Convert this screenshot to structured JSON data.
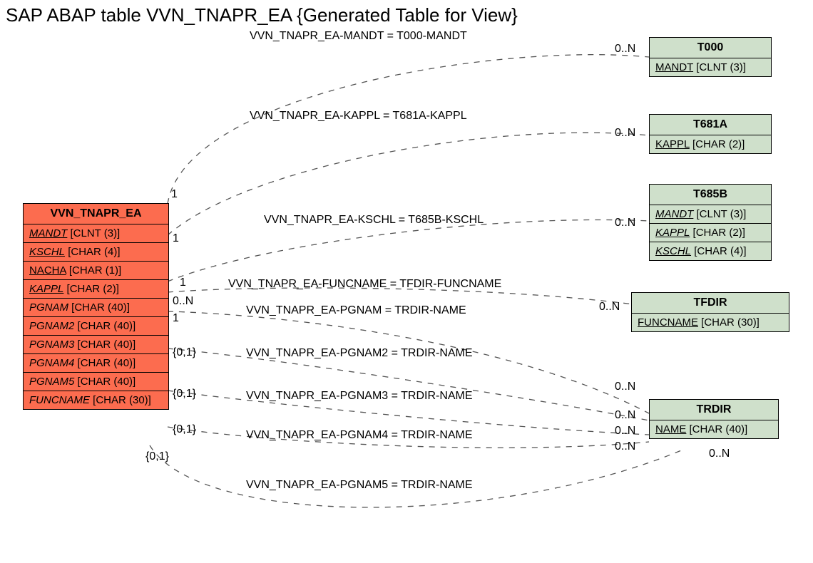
{
  "title": "SAP ABAP table VVN_TNAPR_EA {Generated Table for View}",
  "main": {
    "name": "VVN_TNAPR_EA",
    "cols": [
      {
        "field": "MANDT",
        "type": "[CLNT (3)]",
        "key": true
      },
      {
        "field": "KSCHL",
        "type": "[CHAR (4)]",
        "key": true
      },
      {
        "field": "NACHA",
        "type": "[CHAR (1)]",
        "key": false,
        "u": true
      },
      {
        "field": "KAPPL",
        "type": "[CHAR (2)]",
        "key": true
      },
      {
        "field": "PGNAM",
        "type": "[CHAR (40)]",
        "key": false,
        "i": true
      },
      {
        "field": "PGNAM2",
        "type": "[CHAR (40)]",
        "key": false,
        "i": true
      },
      {
        "field": "PGNAM3",
        "type": "[CHAR (40)]",
        "key": false,
        "i": true
      },
      {
        "field": "PGNAM4",
        "type": "[CHAR (40)]",
        "key": false,
        "i": true
      },
      {
        "field": "PGNAM5",
        "type": "[CHAR (40)]",
        "key": false,
        "i": true
      },
      {
        "field": "FUNCNAME",
        "type": "[CHAR (30)]",
        "key": false,
        "i": true
      }
    ]
  },
  "refs": [
    {
      "name": "T000",
      "cols": [
        {
          "field": "MANDT",
          "type": "[CLNT (3)]",
          "u": true
        }
      ]
    },
    {
      "name": "T681A",
      "cols": [
        {
          "field": "KAPPL",
          "type": "[CHAR (2)]",
          "u": true
        }
      ]
    },
    {
      "name": "T685B",
      "cols": [
        {
          "field": "MANDT",
          "type": "[CLNT (3)]",
          "key": true
        },
        {
          "field": "KAPPL",
          "type": "[CHAR (2)]",
          "key": true
        },
        {
          "field": "KSCHL",
          "type": "[CHAR (4)]",
          "key": true
        }
      ]
    },
    {
      "name": "TFDIR",
      "cols": [
        {
          "field": "FUNCNAME",
          "type": "[CHAR (30)]",
          "u": true
        }
      ]
    },
    {
      "name": "TRDIR",
      "cols": [
        {
          "field": "NAME",
          "type": "[CHAR (40)]",
          "u": true
        }
      ]
    }
  ],
  "rels": [
    "VVN_TNAPR_EA-MANDT = T000-MANDT",
    "VVN_TNAPR_EA-KAPPL = T681A-KAPPL",
    "VVN_TNAPR_EA-KSCHL = T685B-KSCHL",
    "VVN_TNAPR_EA-FUNCNAME = TFDIR-FUNCNAME",
    "VVN_TNAPR_EA-PGNAM = TRDIR-NAME",
    "VVN_TNAPR_EA-PGNAM2 = TRDIR-NAME",
    "VVN_TNAPR_EA-PGNAM3 = TRDIR-NAME",
    "VVN_TNAPR_EA-PGNAM4 = TRDIR-NAME",
    "VVN_TNAPR_EA-PGNAM5 = TRDIR-NAME"
  ],
  "card": {
    "l": [
      "1",
      "1",
      "1",
      "0..N",
      "1",
      "{0,1}",
      "{0,1}",
      "{0,1}",
      "{0,1}"
    ],
    "r": [
      "0..N",
      "0..N",
      "0..N",
      "0..N",
      "0..N",
      "0..N",
      "0..N",
      "0..N",
      "0..N"
    ]
  }
}
